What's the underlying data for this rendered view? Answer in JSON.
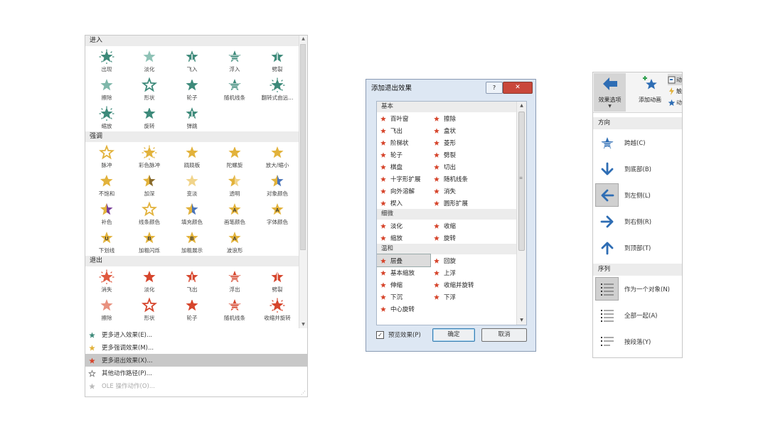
{
  "gallery": {
    "sections": [
      {
        "title": "进入",
        "items": [
          {
            "label": "出现",
            "color": "#3d8a7a",
            "variant": "burst"
          },
          {
            "label": "淡化",
            "color": "#8fc2b6",
            "variant": "plain"
          },
          {
            "label": "飞入",
            "color": "#3d8a7a",
            "variant": "arrow"
          },
          {
            "label": "浮入",
            "color": "#3d8a7a",
            "variant": "lines"
          },
          {
            "label": "劈裂",
            "color": "#3d8a7a",
            "variant": "split"
          },
          {
            "label": "擦除",
            "color": "#7fb7aa",
            "variant": "plain"
          },
          {
            "label": "形状",
            "color": "#3d8a7a",
            "variant": "outline"
          },
          {
            "label": "轮子",
            "color": "#3d8a7a",
            "variant": "wheel"
          },
          {
            "label": "随机线条",
            "color": "#3d8a7a",
            "variant": "lines"
          },
          {
            "label": "翻转式由远...",
            "color": "#3d8a7a",
            "variant": "burst"
          },
          {
            "label": "缩放",
            "color": "#3d8a7a",
            "variant": "burst"
          },
          {
            "label": "旋转",
            "color": "#3d8a7a",
            "variant": "wheel"
          },
          {
            "label": "弹跳",
            "color": "#3d8a7a",
            "variant": "arrow"
          }
        ]
      },
      {
        "title": "强调",
        "items": [
          {
            "label": "脉冲",
            "color": "#e2b23b",
            "variant": "outline"
          },
          {
            "label": "彩色脉冲",
            "color": "#e2b23b",
            "variant": "burst"
          },
          {
            "label": "跷跷板",
            "color": "#e2b23b",
            "variant": "plain"
          },
          {
            "label": "陀螺旋",
            "color": "#e2b23b",
            "variant": "wheel"
          },
          {
            "label": "放大/缩小",
            "color": "#e2b23b",
            "variant": "plain"
          },
          {
            "label": "不饱和",
            "color": "#e2b23b",
            "variant": "half"
          },
          {
            "label": "加深",
            "color": "#8a6b2a",
            "variant": "half"
          },
          {
            "label": "变淡",
            "color": "#f1d48a",
            "variant": "plain"
          },
          {
            "label": "透明",
            "color": "#f1d48a",
            "variant": "half"
          },
          {
            "label": "对象颜色",
            "color": "#4a74b8",
            "variant": "half"
          },
          {
            "label": "补色",
            "color": "#7a3f9a",
            "variant": "half"
          },
          {
            "label": "线条颜色",
            "color": "#e2b23b",
            "variant": "outline"
          },
          {
            "label": "填充颜色",
            "color": "#4a74b8",
            "variant": "half"
          },
          {
            "label": "画笔颜色",
            "color": "#e2b23b",
            "variant": "letterA"
          },
          {
            "label": "字体颜色",
            "color": "#e2b23b",
            "variant": "letterA"
          },
          {
            "label": "下划线",
            "color": "#e2b23b",
            "variant": "letterU"
          },
          {
            "label": "加粗闪烁",
            "color": "#e2b23b",
            "variant": "letterB"
          },
          {
            "label": "加粗展示",
            "color": "#e2b23b",
            "variant": "letterB"
          },
          {
            "label": "波浪形",
            "color": "#e2b23b",
            "variant": "letterA"
          }
        ]
      },
      {
        "title": "退出",
        "items": [
          {
            "label": "消失",
            "color": "#e0593f",
            "variant": "burst"
          },
          {
            "label": "淡化",
            "color": "#d6452c",
            "variant": "plain"
          },
          {
            "label": "飞出",
            "color": "#d6452c",
            "variant": "arrow"
          },
          {
            "label": "浮出",
            "color": "#d6452c",
            "variant": "lines"
          },
          {
            "label": "劈裂",
            "color": "#d6452c",
            "variant": "split"
          },
          {
            "label": "擦除",
            "color": "#e8917f",
            "variant": "plain"
          },
          {
            "label": "形状",
            "color": "#d6452c",
            "variant": "outline"
          },
          {
            "label": "轮子",
            "color": "#d6452c",
            "variant": "wheel"
          },
          {
            "label": "随机线条",
            "color": "#d6452c",
            "variant": "lines"
          },
          {
            "label": "收缩并旋转",
            "color": "#d6452c",
            "variant": "burst"
          }
        ]
      }
    ],
    "more": [
      {
        "label": "更多进入效果(E)...",
        "color": "#3d8a7a",
        "selected": false,
        "disabled": false
      },
      {
        "label": "更多强调效果(M)...",
        "color": "#e2b23b",
        "selected": false,
        "disabled": false
      },
      {
        "label": "更多退出效果(X)...",
        "color": "#d6452c",
        "selected": true,
        "disabled": false
      },
      {
        "label": "其他动作路径(P)...",
        "color": "#777777",
        "selected": false,
        "disabled": false
      },
      {
        "label": "OLE 操作动作(O)...",
        "color": "#bbbbbb",
        "selected": false,
        "disabled": true
      }
    ]
  },
  "dialog": {
    "title": "添加退出效果",
    "help": "?",
    "close": "✕",
    "star_color": "#d6452c",
    "groups": [
      {
        "title": "基本",
        "items": [
          "百叶窗",
          "擦除",
          "飞出",
          "盒状",
          "阶梯状",
          "菱形",
          "轮子",
          "劈裂",
          "棋盘",
          "切出",
          "十字形扩展",
          "随机线条",
          "向外溶解",
          "消失",
          "楔入",
          "圆形扩展"
        ]
      },
      {
        "title": "细微",
        "items": [
          "淡化",
          "收缩",
          "缩放",
          "旋转"
        ]
      },
      {
        "title": "温和",
        "items": [
          "层叠",
          "回旋",
          "基本缩放",
          "上浮",
          "伸缩",
          "收缩并旋转",
          "下沉",
          "下浮",
          "中心旋转"
        ]
      }
    ],
    "selected_item": "层叠",
    "preview_label": "预览效果(P)",
    "preview_checked": "✓",
    "ok_label": "确定",
    "cancel_label": "取消"
  },
  "effects": {
    "ribbon": {
      "effect_options": "效果选项",
      "add_animation": "添加动画",
      "side": [
        "动",
        "触",
        "动"
      ]
    },
    "direction_title": "方向",
    "directions": [
      {
        "label": "跨越(C)",
        "icon": "cross-icon",
        "selected": false
      },
      {
        "label": "到底部(B)",
        "icon": "arrow-down-icon",
        "selected": false
      },
      {
        "label": "到左侧(L)",
        "icon": "arrow-left-icon",
        "selected": true
      },
      {
        "label": "到右侧(R)",
        "icon": "arrow-right-icon",
        "selected": false
      },
      {
        "label": "到顶部(T)",
        "icon": "arrow-up-icon",
        "selected": false
      }
    ],
    "sequence_title": "序列",
    "sequences": [
      {
        "label": "作为一个对象(N)",
        "icon": "list-object-icon",
        "selected": true
      },
      {
        "label": "全部一起(A)",
        "icon": "list-all-icon",
        "selected": false
      },
      {
        "label": "按段落(Y)",
        "icon": "list-paragraph-icon",
        "selected": false
      }
    ],
    "accent": "#2e6db4"
  }
}
